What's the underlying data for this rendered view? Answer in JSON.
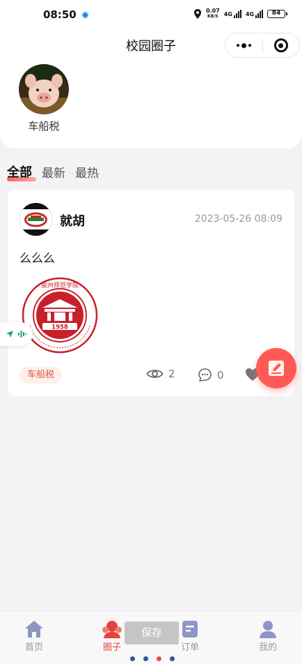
{
  "status_bar": {
    "time": "08:50",
    "network_speed": "0.07",
    "network_unit": "KB/S",
    "gen1": "4G",
    "gen2": "4G",
    "battery": "84"
  },
  "header": {
    "title": "校园圈子"
  },
  "circle": {
    "name": "车船税",
    "avatar_icon": "pig-photo"
  },
  "tabs": [
    {
      "label": "全部",
      "active": true
    },
    {
      "label": "最新",
      "active": false
    },
    {
      "label": "最热",
      "active": false
    }
  ],
  "post": {
    "author": "就胡",
    "timestamp": "2023-05-26 08:09",
    "content": "么么么",
    "image_year": "1958",
    "image_text": "泉州师范学院",
    "tag": "车船税",
    "views": "2",
    "comments": "0"
  },
  "save_button": "保存",
  "bottom_nav": [
    {
      "label": "首页",
      "icon": "home-icon",
      "active": false
    },
    {
      "label": "圈子",
      "icon": "group-icon",
      "active": true
    },
    {
      "label": "订单",
      "icon": "order-icon",
      "active": false
    },
    {
      "label": "我的",
      "icon": "user-icon",
      "active": false
    }
  ],
  "colors": {
    "accent": "#e8413c",
    "fab": "#ff5a55",
    "tag_bg": "#fdf0ec"
  }
}
